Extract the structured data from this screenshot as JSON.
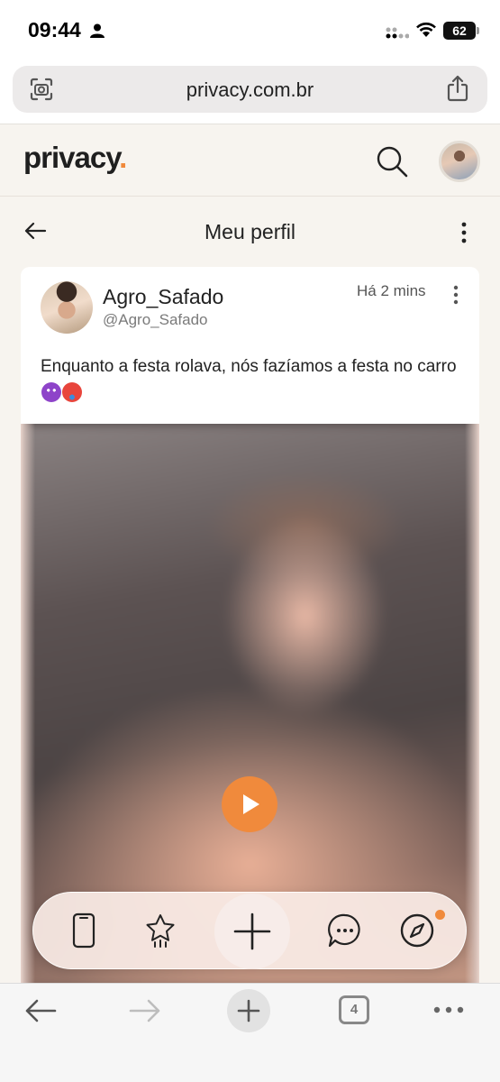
{
  "status_bar": {
    "time": "09:44",
    "battery": "62"
  },
  "browser": {
    "url": "privacy.com.br",
    "tab_count": "4"
  },
  "site": {
    "logo": "privacy",
    "logo_dot": "."
  },
  "profile_bar": {
    "title": "Meu perfil"
  },
  "post": {
    "author_name": "Agro_Safado",
    "author_handle": "@Agro_Safado",
    "time": "Há 2 mins",
    "text": "Enquanto a festa rolava, nós fazíamos a festa no carro"
  },
  "colors": {
    "accent": "#f08a3c",
    "background": "#f7f4ef"
  },
  "icons": {
    "dock": [
      "phone-icon",
      "star-feed-icon",
      "plus-icon",
      "chat-icon",
      "compass-icon"
    ],
    "browser_bottom": [
      "back-arrow-icon",
      "forward-arrow-icon",
      "new-tab-icon",
      "tabs-icon",
      "more-icon"
    ]
  }
}
